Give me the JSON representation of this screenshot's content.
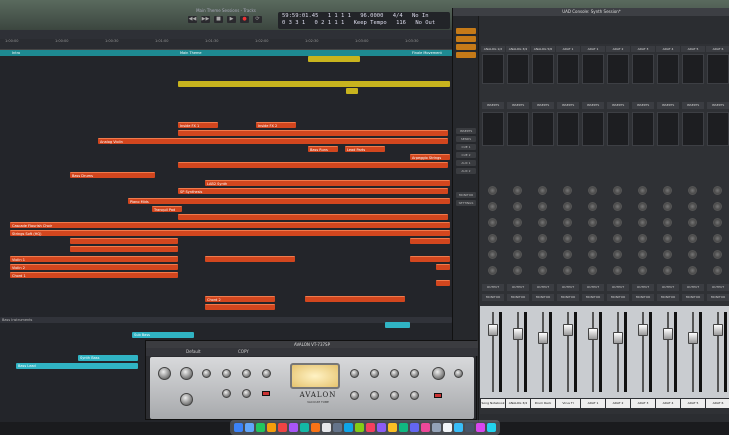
{
  "window": {
    "title": "Main Theme Sessions - Tracks"
  },
  "transport": {
    "position": "59:59:01.45",
    "bars": "0 3 3 1",
    "beats": "1 1 1 1",
    "beats2": "0 2 1 1 1",
    "tempo": "96.0000",
    "tempo_label": "Keep Tempo",
    "sig": "4/4",
    "sig2": "116",
    "in": "No In",
    "out": "No Out"
  },
  "ruler": {
    "ticks": [
      "1:00:00",
      "1:00:00",
      "1:00:30",
      "1:01:00",
      "1:01:30",
      "1:02:00",
      "1:02:30",
      "1:03:00",
      "1:03:30",
      "1:04:00"
    ]
  },
  "arrange": {
    "markers": [
      "Intro",
      "Main Theme",
      "Finale Movement"
    ],
    "regions": [
      {
        "label": "Main Theme",
        "row": "green"
      },
      {
        "label": "Inside FX 1",
        "row": "y1"
      },
      {
        "label": "Inside FX 2",
        "row": "y1"
      },
      {
        "label": "Analog Violin",
        "row": "o1"
      },
      {
        "label": "Bass Runs",
        "row": "o2"
      },
      {
        "label": "Lead Parts",
        "row": "o2"
      },
      {
        "label": "Arpeggio Strings",
        "row": "o3"
      },
      {
        "label": "Bass Drums",
        "row": "o4"
      },
      {
        "label": "LAB2 Synth",
        "row": "o5"
      },
      {
        "label": "SP Synthesis",
        "row": "o6"
      },
      {
        "label": "Piano Mids",
        "row": "o7"
      },
      {
        "label": "Tranquil Pad",
        "row": "o8"
      },
      {
        "label": "Cascade Flourish Choir",
        "row": "o9"
      },
      {
        "label": "Strings Soft (HQ)",
        "row": "o10"
      },
      {
        "label": "Violin 1",
        "row": "o11"
      },
      {
        "label": "Violin 2",
        "row": "o12"
      },
      {
        "label": "Chord 1",
        "row": "o13"
      },
      {
        "label": "Chord 2",
        "row": "o14"
      },
      {
        "label": "Bass Instruments",
        "row": "o15"
      },
      {
        "label": "Sub Bass",
        "row": "c1"
      },
      {
        "label": "Synth Bass",
        "row": "c2"
      },
      {
        "label": "Bass Lead",
        "row": "c3"
      }
    ]
  },
  "mixer": {
    "title": "UAD Console: Synth Session*",
    "side_buttons": [
      "INSERTS",
      "SENDS",
      "CUE 1",
      "CUE 2",
      "AUX 1",
      "AUX 2",
      "MONITOR",
      "SETTINGS"
    ],
    "channels": [
      {
        "name": "Song Notebook",
        "input": "ANALOG 1/2"
      },
      {
        "name": "ANALOG 3/4",
        "input": "ANALOG 3/4"
      },
      {
        "name": "Drum Rack",
        "input": "ANALOG 5/6"
      },
      {
        "name": "Virus TI",
        "input": "ADAT 1"
      },
      {
        "name": "ADAT 1",
        "input": "ADAT 1"
      },
      {
        "name": "ADAT 2",
        "input": "ADAT 2"
      },
      {
        "name": "ADAT 3",
        "input": "ADAT 3"
      },
      {
        "name": "ADAT 4",
        "input": "ADAT 4"
      },
      {
        "name": "ADAT 5",
        "input": "ADAT 5"
      },
      {
        "name": "ADAT 6",
        "input": "ADAT 6"
      }
    ],
    "labels": {
      "output": "OUTPUT",
      "monitor": "MONITOR",
      "inserts": "INSERTS",
      "sends": "SENDS",
      "cue1": "CUE 1",
      "cue2": "CUE 2",
      "aux1": "AUX 1",
      "aux2": "AUX 2"
    }
  },
  "plugin": {
    "window_title": "AVALON VT-737SP",
    "preset": "Default",
    "copy_label": "COPY",
    "brand": "AVALON",
    "model": "VACUUM TUBE"
  },
  "colors": {
    "orange": "#d2461e",
    "yellow": "#c8b41e",
    "cyan": "#30b4c4",
    "teal": "#1e8a92"
  }
}
